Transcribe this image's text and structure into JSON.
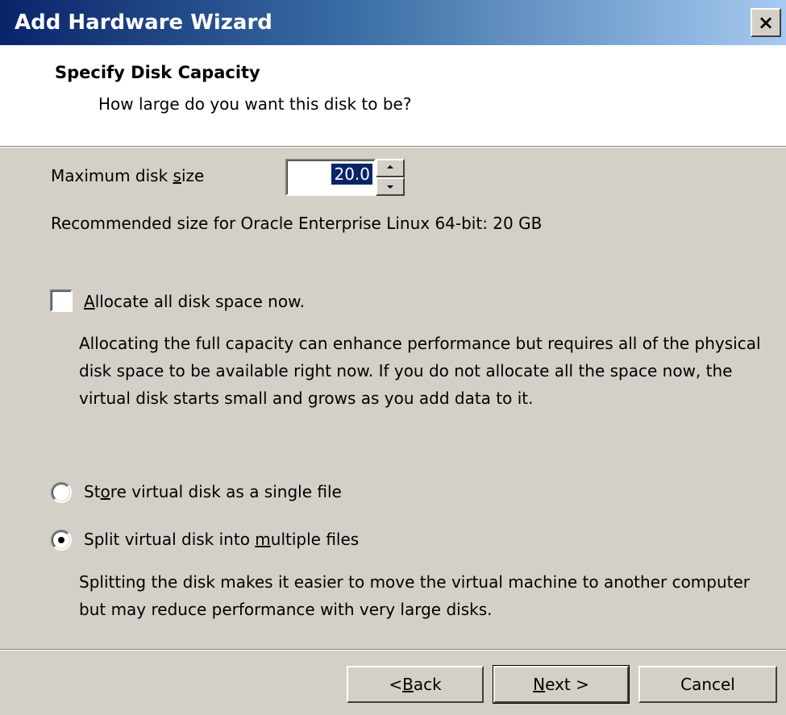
{
  "window": {
    "title": "Add Hardware Wizard",
    "close_label": "×"
  },
  "header": {
    "title": "Specify Disk Capacity",
    "subtitle": "How large do you want this disk to be?"
  },
  "disk_size": {
    "label_pre": "Maximum disk ",
    "label_key": "s",
    "label_post": "ize",
    "value": "20.0",
    "recommended": "Recommended size for Oracle Enterprise Linux 64-bit: 20 GB"
  },
  "allocate": {
    "checked": false,
    "label_key": "A",
    "label_post": "llocate all disk space now.",
    "description": "Allocating the full capacity can enhance performance but requires all of the physical disk space to be available right now. If you do not allocate all the space now, the virtual disk starts small and grows as you add data to it."
  },
  "storage_options": [
    {
      "label_pre": "St",
      "label_key": "o",
      "label_post": "re virtual disk as a single file",
      "selected": false
    },
    {
      "label_pre": "Split virtual disk into ",
      "label_key": "m",
      "label_post": "ultiple files",
      "selected": true
    }
  ],
  "split_description": "Splitting the disk makes it easier to move the virtual machine to another computer but may reduce performance with very large disks.",
  "buttons": {
    "back_pre": "< ",
    "back_key": "B",
    "back_post": "ack",
    "next_key": "N",
    "next_post": "ext >",
    "cancel": "Cancel"
  },
  "colors": {
    "titlebar_start": "#0a246a",
    "titlebar_end": "#a6caf0",
    "dialog_face": "#d4d0c8",
    "selection": "#0a246a"
  }
}
